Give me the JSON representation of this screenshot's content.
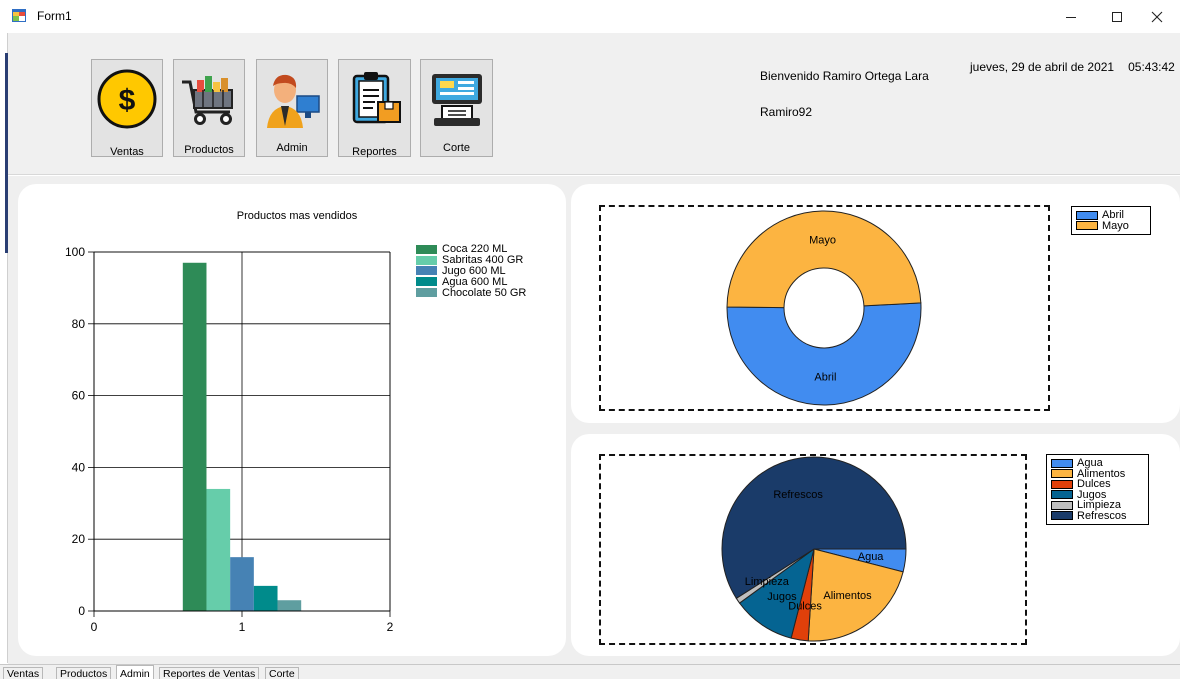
{
  "window": {
    "title": "Form1"
  },
  "nav_buttons": [
    {
      "label": "Ventas",
      "icon": "dollar-coin-icon"
    },
    {
      "label": "Productos",
      "icon": "shopping-cart-icon"
    },
    {
      "label": "Admin",
      "icon": "admin-user-icon"
    },
    {
      "label": "Reportes",
      "icon": "report-clipboard-icon"
    },
    {
      "label": "Corte",
      "icon": "cash-register-icon"
    }
  ],
  "header": {
    "welcome": "Bienvenido Ramiro Ortega Lara",
    "username": "Ramiro92",
    "date": "jueves, 29 de abril de 2021",
    "time": "05:43:42"
  },
  "chart_data": [
    {
      "type": "bar",
      "title": "Productos mas vendidos",
      "xlim": [
        0,
        2
      ],
      "ylim": [
        0,
        100
      ],
      "xticks": [
        0,
        1,
        2
      ],
      "yticks": [
        0,
        20,
        40,
        60,
        80,
        100
      ],
      "grid": true,
      "legend_position": "top-right",
      "series": [
        {
          "name": "Coca 220 ML",
          "values": [
            97
          ],
          "color": "#2e8b57"
        },
        {
          "name": "Sabritas 400 GR",
          "values": [
            34
          ],
          "color": "#66cdaa"
        },
        {
          "name": "Jugo 600 ML",
          "values": [
            15
          ],
          "color": "#4682b4"
        },
        {
          "name": "Agua 600 ML",
          "values": [
            7
          ],
          "color": "#008b8b"
        },
        {
          "name": "Chocolate 50 GR",
          "values": [
            3
          ],
          "color": "#5f9ea0"
        }
      ]
    },
    {
      "type": "pie",
      "variant": "doughnut",
      "legend_position": "top-right",
      "slices": [
        {
          "label": "Abril",
          "value": 51,
          "color": "#418cf0"
        },
        {
          "label": "Mayo",
          "value": 49,
          "color": "#fcb441"
        }
      ]
    },
    {
      "type": "pie",
      "legend_position": "top-right",
      "slices": [
        {
          "label": "Agua",
          "value": 4,
          "color": "#418cf0"
        },
        {
          "label": "Alimentos",
          "value": 22,
          "color": "#fcb441"
        },
        {
          "label": "Dulces",
          "value": 3,
          "color": "#e0400a"
        },
        {
          "label": "Jugos",
          "value": 11,
          "color": "#056492"
        },
        {
          "label": "Limpieza",
          "value": 1,
          "color": "#bfbfbf"
        },
        {
          "label": "Refrescos",
          "value": 59,
          "color": "#1a3b69"
        }
      ]
    }
  ],
  "tabs": [
    {
      "label": "Ventas"
    },
    {
      "label": "Productos"
    },
    {
      "label": "Admin",
      "active": true
    },
    {
      "label": "Reportes de Ventas"
    },
    {
      "label": "Corte"
    }
  ]
}
